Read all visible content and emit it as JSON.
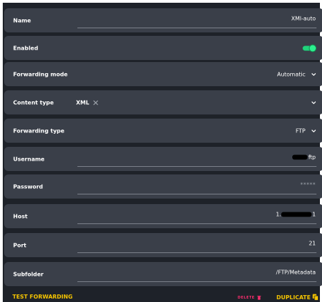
{
  "fields": {
    "name": {
      "label": "Name",
      "value": "XMl-auto"
    },
    "enabled": {
      "label": "Enabled",
      "on": true
    },
    "forwarding_mode": {
      "label": "Forwarding mode",
      "value": "Automatic"
    },
    "content_type": {
      "label": "Content type",
      "chip": "XML"
    },
    "forwarding_type": {
      "label": "Forwarding type",
      "value": "FTP"
    },
    "username": {
      "label": "Username",
      "value_suffix": "ftp"
    },
    "password": {
      "label": "Password",
      "value": "*****"
    },
    "host": {
      "label": "Host",
      "value_prefix": "1.",
      "value_suffix": "1"
    },
    "port": {
      "label": "Port",
      "value": "21"
    },
    "subfolder": {
      "label": "Subfolder",
      "value": "/FTP/Metadata"
    }
  },
  "actions": {
    "test": "TEST FORWARDING",
    "delete": "DELETE",
    "duplicate": "DUPLICATE"
  },
  "colors": {
    "accent": "#f5c400",
    "danger": "#ff2d6e",
    "toggle_on": "#1fd37a",
    "row_bg": "#3a3f49",
    "panel_bg": "#1e2229"
  },
  "icons": [
    "chevron-down-icon",
    "close-icon",
    "trash-icon",
    "copy-icon"
  ]
}
